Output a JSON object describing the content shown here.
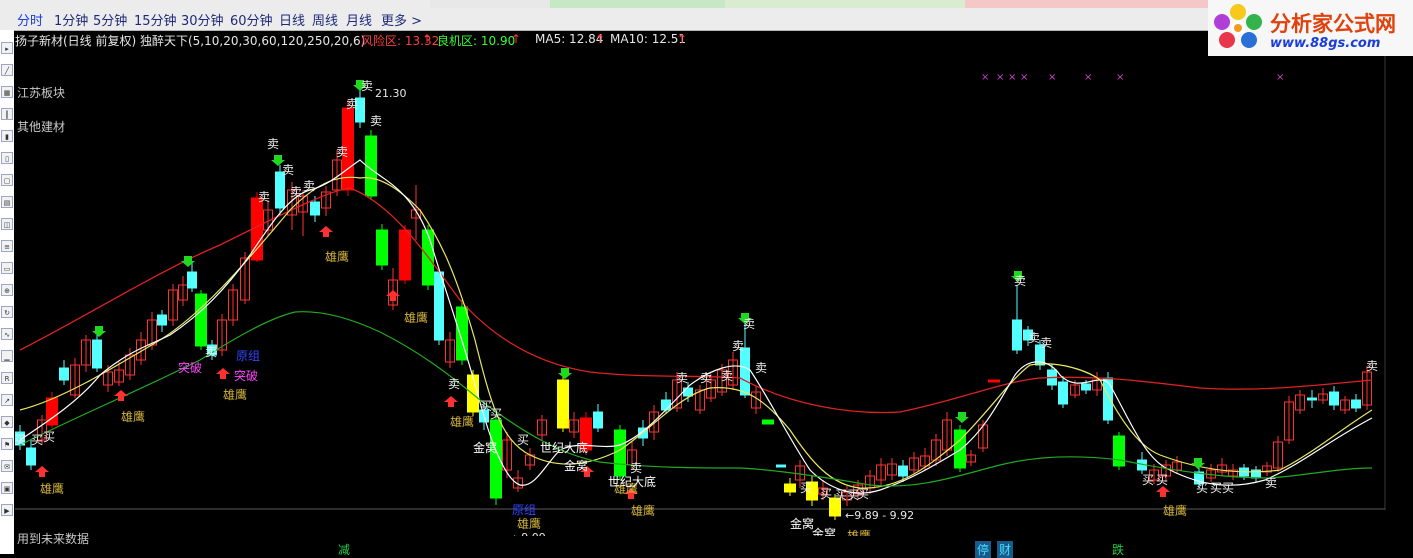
{
  "toolbar": {
    "intervals": [
      "分时",
      "1分钟",
      "5分钟",
      "15分钟",
      "30分钟",
      "60分钟",
      "日线",
      "周线",
      "月线",
      "更多 >"
    ],
    "active_index": 0
  },
  "brand": {
    "name": "分析家公式网",
    "url": "www.88gs.com"
  },
  "info": {
    "title": "扬子新材(日线 前复权) 独醉天下(5,10,20,30,60,120,250,20,6)",
    "risk_label": "风险区: 13.32",
    "chance_label": "良机区: 10.90",
    "ma5_label": "MA5: 12.84",
    "ma10_label": "MA10: 12.51",
    "up_arrow": "↑"
  },
  "sidebar": {
    "sector1": "江苏板块",
    "sector2": "其他建材"
  },
  "footer": {
    "note": "用到未来数据",
    "mark_jian": "减",
    "mark_ting": "停",
    "mark_cai": "财",
    "mark_die": "跌"
  },
  "colors": {
    "up": "#ff3232",
    "down": "#54ffff",
    "bull_signal": "#ff0000",
    "bear_signal": "#00ff00",
    "gold": "#ffff00",
    "ma_yellow": "#ffff66",
    "ma_white": "#ffffff",
    "ma_red": "#dd2222",
    "ma_green": "#22aa22",
    "label_gold": "#d4b43c"
  },
  "chart_data": {
    "type": "candlestick",
    "price_labels": {
      "high": "21.30",
      "low": "9.09",
      "range": "9.89 - 9.92"
    },
    "signals": {
      "sell": "卖",
      "buy": "买",
      "eagle": "雄鹰",
      "breakout": "突破",
      "gold_nest": "金窝",
      "century_bottom": "世纪大底",
      "reversal": "原组"
    }
  }
}
